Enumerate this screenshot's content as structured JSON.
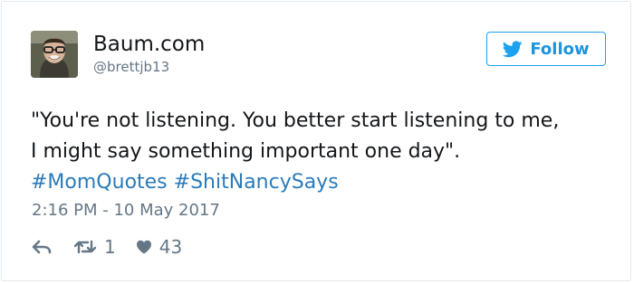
{
  "user": {
    "display_name": "Baum.com",
    "handle": "@brettjb13",
    "avatar_icon": "user-photo-avatar"
  },
  "follow_button": {
    "label": "Follow",
    "icon": "twitter-bird-icon",
    "accent_color": "#1da1f2"
  },
  "tweet": {
    "lines": [
      "\"You're not listening. You better start listening to me,",
      "I might say something important one day\"."
    ],
    "hashtags": [
      "#MomQuotes",
      "#ShitNancySays"
    ],
    "timestamp": "2:16 PM - 10 May 2017"
  },
  "actions": {
    "reply_icon": "reply-icon",
    "retweet_icon": "retweet-icon",
    "retweet_count": "1",
    "like_icon": "heart-icon",
    "like_count": "43"
  },
  "colors": {
    "text": "#14171a",
    "muted": "#657786",
    "link": "#2b7bb9",
    "border": "#e1e8ed"
  }
}
